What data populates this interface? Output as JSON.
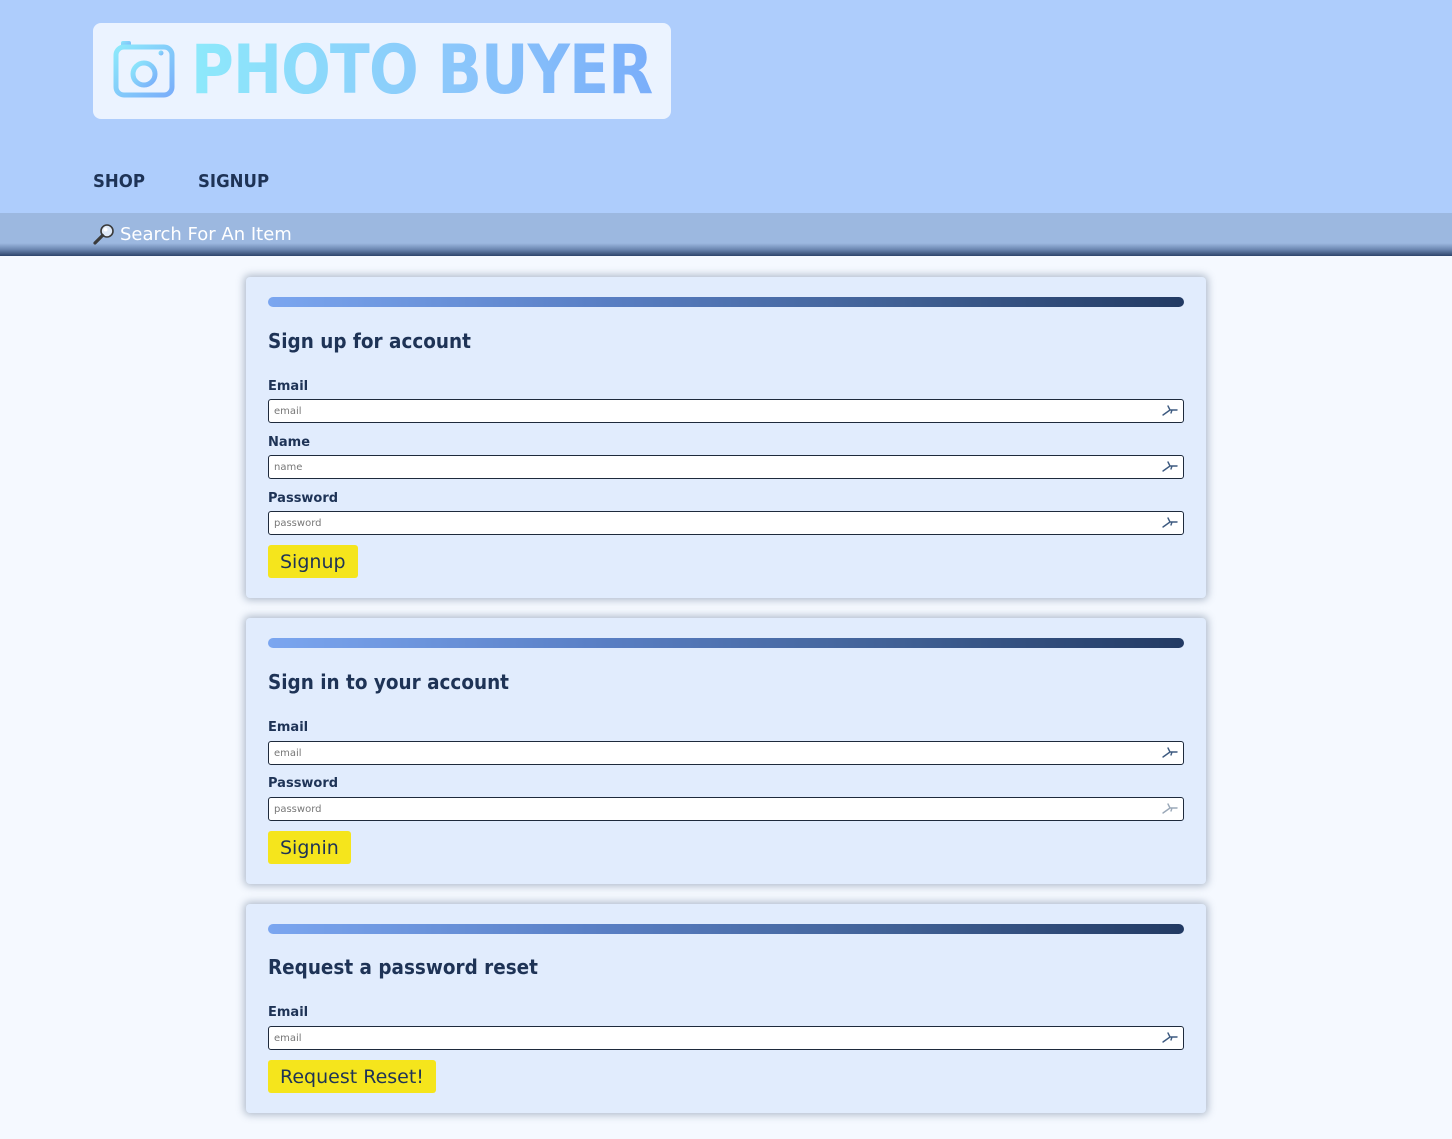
{
  "header": {
    "logo_text": "PHOTO BUYER",
    "nav": {
      "shop": "SHOP",
      "signup": "SIGNUP"
    }
  },
  "search": {
    "placeholder": "Search For An Item",
    "icon": "magnifying-glass-icon"
  },
  "signup_form": {
    "title": "Sign up for account",
    "email_label": "Email",
    "email_placeholder": "email",
    "name_label": "Name",
    "name_placeholder": "name",
    "password_label": "Password",
    "password_placeholder": "password",
    "submit_label": "Signup"
  },
  "signin_form": {
    "title": "Sign in to your account",
    "email_label": "Email",
    "email_placeholder": "email",
    "password_label": "Password",
    "password_placeholder": "password",
    "submit_label": "Signin"
  },
  "reset_form": {
    "title": "Request a password reset",
    "email_label": "Email",
    "email_placeholder": "email",
    "submit_label": "Request Reset!"
  },
  "colors": {
    "header_bg": "#aecdfc",
    "card_bg": "#e1ecfd",
    "button_bg": "#f5e51c",
    "text_dark": "#1e3356"
  }
}
